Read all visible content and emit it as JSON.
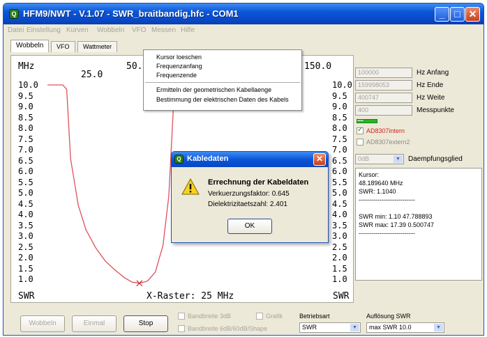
{
  "window": {
    "title": "HFM9/NWT - V.1.07 - SWR_braitbandig.hfc - COM1",
    "min": "_",
    "max": "□",
    "close": "✕"
  },
  "menu": [
    "Datei",
    "Einstellung",
    "Kurven",
    "Wobbeln",
    "VFO",
    "Messen",
    "Hilfe"
  ],
  "tabs": [
    "Wobbeln",
    "VFO",
    "Wattmeter"
  ],
  "plot": {
    "unit_top": "MHz",
    "freq_labels": [
      "25.0",
      "50.",
      "150.0"
    ],
    "y_ticks": [
      "10.0",
      "9.5",
      "9.0",
      "8.5",
      "8.0",
      "7.5",
      "7.0",
      "6.5",
      "6.0",
      "5.5",
      "5.0",
      "4.5",
      "4.0",
      "3.5",
      "3.0",
      "2.5",
      "2.0",
      "1.5",
      "1.0"
    ],
    "y_label": "SWR",
    "x_raster": "X-Raster: 25 MHz",
    "curve_color": "#e0505a"
  },
  "chart_data": {
    "type": "line",
    "title": "",
    "xlabel": "X-Raster: 25 MHz",
    "ylabel": "SWR",
    "xlim": [
      0,
      150
    ],
    "ylim": [
      1.0,
      10.0
    ],
    "series": [
      {
        "x": [
          0,
          8,
          10,
          12,
          16,
          20,
          25,
          30,
          35,
          40,
          44,
          47.79,
          52,
          56,
          60,
          63,
          66
        ],
        "values": [
          10.0,
          10.0,
          9.8,
          6.7,
          4.6,
          3.5,
          2.7,
          2.1,
          1.7,
          1.35,
          1.15,
          1.1,
          1.2,
          1.6,
          2.8,
          5.0,
          10.0
        ]
      }
    ],
    "marker": {
      "x": 47.79,
      "y": 1.1
    }
  },
  "side": {
    "fields": [
      {
        "value": "100000",
        "label": "Hz Anfang"
      },
      {
        "value": "159998053",
        "label": "Hz Ende"
      },
      {
        "value": "400747",
        "label": "Hz Weite"
      },
      {
        "value": "400",
        "label": "Messpunkte"
      }
    ],
    "progress": "▪▪▪▪",
    "check1": "AD8307intern",
    "check2": "AD8307extern2",
    "daempf_value": "0dB",
    "daempf_label": "Daempfungsglied",
    "info": [
      "Kursor:",
      "48.189640 MHz",
      "SWR: 1.1040",
      "---------------------------",
      "",
      "SWR min: 1.10  47.788893",
      "SWR max: 17.39  0.500747",
      "---------------------------"
    ]
  },
  "bottom": {
    "btn_wobbeln": "Wobbeln",
    "btn_einmal": "Einmal",
    "btn_stop": "Stop",
    "bw3": "Bandbreite 3dB",
    "bw6": "Bandbreite 6dB/60dB/Shape",
    "grafik": "Grafik",
    "betriebsart_label": "Betriebsart",
    "betriebsart_value": "SWR",
    "aufl_label": "Auflösung SWR",
    "aufl_value": "max SWR 10.0"
  },
  "context_menu": {
    "items": [
      "Kursor loeschen",
      "Frequenzanfang",
      "Frequenzende"
    ],
    "items2": [
      "Ermitteln der geometrischen Kabellaenge",
      "Bestimmung der elektrischen Daten des Kabels"
    ]
  },
  "dialog": {
    "title": "Kabledaten",
    "heading": "Errechnung der Kabeldaten",
    "line1": "Verkuerzungsfaktor: 0.645",
    "line2": "Dielektrizitaetszahl: 2.401",
    "ok": "OK"
  }
}
